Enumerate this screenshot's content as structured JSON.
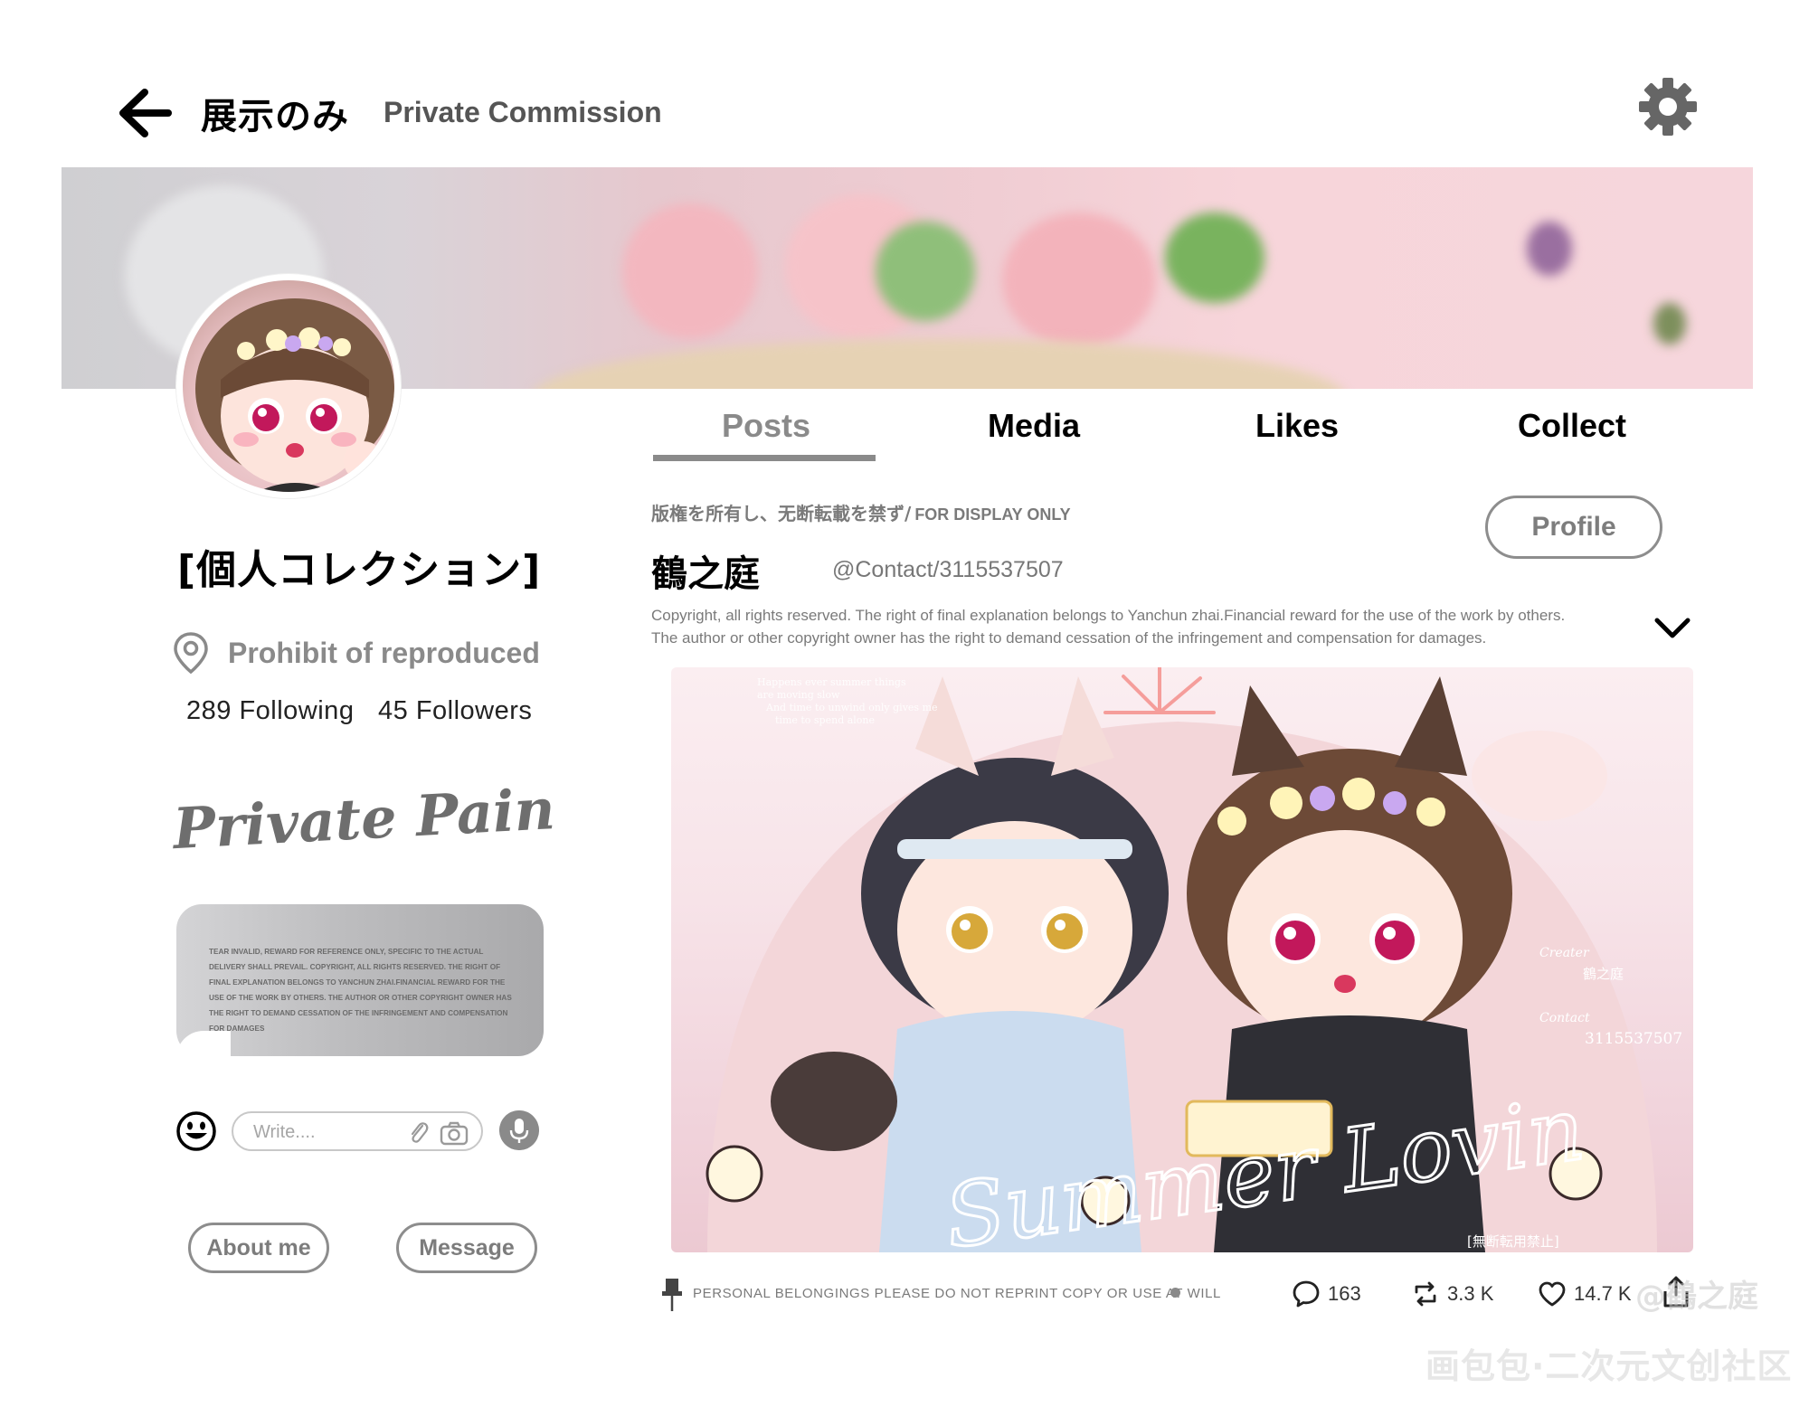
{
  "header": {
    "title": "展示のみ",
    "subtitle": "Private Commission"
  },
  "profile": {
    "collection_title": "[個人コレクション]",
    "location": "Prohibit of reproduced",
    "following": "289 Following",
    "followers": "45 Followers",
    "signature": "Private Painting",
    "note": "TEAR INVALID, REWARD FOR REFERENCE ONLY, SPECIFIC TO THE ACTUAL DELIVERY SHALL PREVAIL. COPYRIGHT, ALL RIGHTS RESERVED. THE RIGHT OF FINAL EXPLANATION BELONGS TO YANCHUN ZHAI.FINANCIAL REWARD FOR THE USE OF THE WORK BY OTHERS. THE AUTHOR OR OTHER COPYRIGHT OWNER HAS THE RIGHT TO DEMAND CESSATION OF THE INFRINGEMENT AND COMPENSATION FOR DAMAGES",
    "write_placeholder": "Write....",
    "about_label": "About me",
    "message_label": "Message"
  },
  "tabs": [
    {
      "label": "Posts",
      "active": true
    },
    {
      "label": "Media",
      "active": false
    },
    {
      "label": "Likes",
      "active": false
    },
    {
      "label": "Collect",
      "active": false
    }
  ],
  "post": {
    "notice_jp": "版権を所有し、无断転載を禁ず/",
    "notice_en": "FOR DISPLAY ONLY",
    "profile_label": "Profile",
    "author": "鶴之庭",
    "handle": "@Contact/3115537507",
    "copyright_line1": "Copyright, all rights reserved. The right of final explanation belongs to Yanchun zhai.Financial reward for the use of the work by others.",
    "copyright_line2": "The author or other copyright owner has the right to demand cessation of the infringement and compensation for damages.",
    "artwork": {
      "poem": [
        "Happens ever summer things",
        "are moving slow",
        "And time to unwind only gives me",
        "time to spend alone"
      ],
      "creator_label": "Creater",
      "creator": "鶴之庭",
      "contact_label": "Contact",
      "contact": "3115537507",
      "script_title": "Summer Lovin",
      "stamp": "[無断転用禁止]"
    },
    "footer_note": "PERSONAL BELONGINGS PLEASE DO NOT REPRINT COPY OR USE AT WILL",
    "comments": "163",
    "reposts": "3.3 K",
    "likes": "14.7 K"
  },
  "watermarks": {
    "handle": "@鶴之庭",
    "site": "画包包·二次元文创社区"
  },
  "colors": {
    "accent_gray": "#8a8a8a",
    "banner_pink": "#f0cdd3",
    "art_bg": "#f7e3e8"
  },
  "icons": [
    "back-arrow-icon",
    "gear-icon",
    "location-pin-icon",
    "smiley-icon",
    "paperclip-icon",
    "camera-icon",
    "microphone-icon",
    "chevron-down-icon",
    "pushpin-icon",
    "comment-icon",
    "repost-icon",
    "heart-icon",
    "share-icon"
  ]
}
